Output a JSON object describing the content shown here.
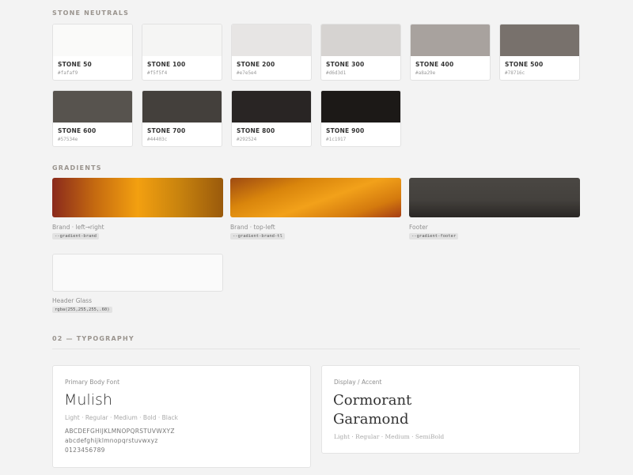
{
  "stone": {
    "title": "STONE NEUTRALS",
    "swatches": [
      {
        "name": "STONE 50",
        "hex": "#fafaf9"
      },
      {
        "name": "STONE 100",
        "hex": "#f5f5f4"
      },
      {
        "name": "STONE 200",
        "hex": "#e7e5e4"
      },
      {
        "name": "STONE 300",
        "hex": "#d6d3d1"
      },
      {
        "name": "STONE 400",
        "hex": "#a8a29e"
      },
      {
        "name": "STONE 500",
        "hex": "#78716c"
      },
      {
        "name": "STONE 600",
        "hex": "#57534e"
      },
      {
        "name": "STONE 700",
        "hex": "#44403c"
      },
      {
        "name": "STONE 800",
        "hex": "#292524"
      },
      {
        "name": "STONE 900",
        "hex": "#1c1917"
      }
    ]
  },
  "gradients": {
    "title": "GRADIENTS",
    "items": [
      {
        "label": "Brand · left→right",
        "token": "--gradient-brand"
      },
      {
        "label": "Brand · top-left",
        "token": "--gradient-brand-tl"
      },
      {
        "label": "Footer",
        "token": "--gradient-footer"
      },
      {
        "label": "Header Glass",
        "token": "rgba(255,255,255,.60)"
      }
    ]
  },
  "typography": {
    "title": "02 — TYPOGRAPHY",
    "primary": {
      "caption": "Primary Body Font",
      "name": "Mulish",
      "weights": "Light · Regular · Medium · Bold · Black",
      "upper": "ABCDEFGHIJKLMNOPQRSTUVWXYZ",
      "lower": "abcdefghijklmnopqrstuvwxyz",
      "digits": "0123456789"
    },
    "display": {
      "caption": "Display / Accent",
      "name_line1": "Cormorant",
      "name_line2": "Garamond",
      "weights": "Light · Regular · Medium · SemiBold"
    }
  }
}
